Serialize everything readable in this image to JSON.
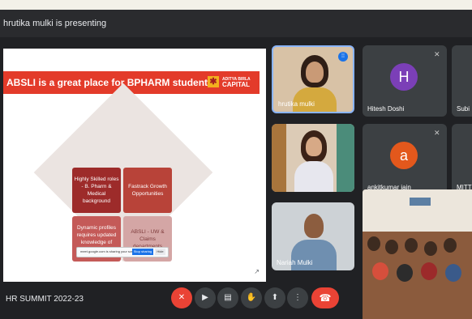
{
  "presenting_bar": {
    "text": "hrutika mulki is presenting"
  },
  "slide": {
    "title": "ABSLI is a great place for BPHARM students",
    "logo_line1": "ADITYA BIRLA",
    "logo_line2": "CAPITAL",
    "tiles": [
      "Highly Skilled roles - B. Pharm & Medical background",
      "Fastrack Growth Opportunities",
      "Dynamic profiles requires updated knowledge of current affair",
      "ABSLI - UW & Claims departments"
    ],
    "popup_text": "meet.google.com is sharing your screen.",
    "popup_stop": "Stop sharing",
    "popup_hide": "Hide"
  },
  "participants": {
    "cam1": "hrutika mulki",
    "cam3": "Nariah Mulki",
    "tile1_name": "Hitesh Doshi",
    "tile1_avatar": "H",
    "tile1_color": "#7b3fb7",
    "tile2_name": "ankitkumar jain",
    "tile2_avatar": "a",
    "tile2_color": "#e3581c",
    "tile3_name": "Subi",
    "tile4_name": "MITT"
  },
  "controls": {
    "meeting_name": "HR SUMMIT 2022-23",
    "leave": "end-call",
    "icons": [
      "mic-off-icon",
      "camera-icon",
      "captions-icon",
      "raise-hand-icon",
      "present-icon",
      "more-icon"
    ]
  }
}
